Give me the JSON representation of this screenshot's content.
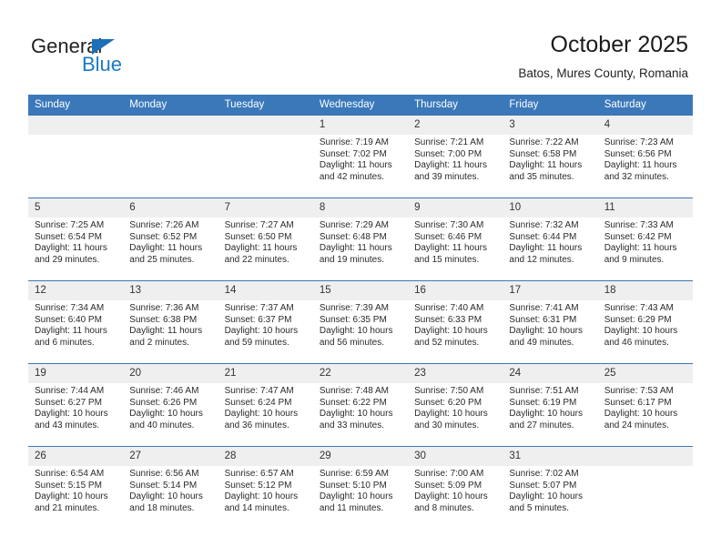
{
  "brand": {
    "name_top": "General",
    "name_bottom": "Blue",
    "triangle_color": "#1d6fb8",
    "blue_color": "#1d7ac2"
  },
  "header": {
    "title": "October 2025",
    "subtitle": "Batos, Mures County, Romania"
  },
  "theme": {
    "header_blue": "#3a78ba",
    "daynum_bg": "#efeff0",
    "text": "#2a2a2a"
  },
  "weekdays": [
    "Sunday",
    "Monday",
    "Tuesday",
    "Wednesday",
    "Thursday",
    "Friday",
    "Saturday"
  ],
  "labels": {
    "sunrise": "Sunrise:",
    "sunset": "Sunset:",
    "daylight": "Daylight:"
  },
  "weeks": [
    [
      {
        "day": "",
        "blank": true
      },
      {
        "day": "",
        "blank": true
      },
      {
        "day": "",
        "blank": true
      },
      {
        "day": "1",
        "sunrise": "Sunrise: 7:19 AM",
        "sunset": "Sunset: 7:02 PM",
        "daylight_1": "Daylight: 11 hours",
        "daylight_2": "and 42 minutes."
      },
      {
        "day": "2",
        "sunrise": "Sunrise: 7:21 AM",
        "sunset": "Sunset: 7:00 PM",
        "daylight_1": "Daylight: 11 hours",
        "daylight_2": "and 39 minutes."
      },
      {
        "day": "3",
        "sunrise": "Sunrise: 7:22 AM",
        "sunset": "Sunset: 6:58 PM",
        "daylight_1": "Daylight: 11 hours",
        "daylight_2": "and 35 minutes."
      },
      {
        "day": "4",
        "sunrise": "Sunrise: 7:23 AM",
        "sunset": "Sunset: 6:56 PM",
        "daylight_1": "Daylight: 11 hours",
        "daylight_2": "and 32 minutes."
      }
    ],
    [
      {
        "day": "5",
        "sunrise": "Sunrise: 7:25 AM",
        "sunset": "Sunset: 6:54 PM",
        "daylight_1": "Daylight: 11 hours",
        "daylight_2": "and 29 minutes."
      },
      {
        "day": "6",
        "sunrise": "Sunrise: 7:26 AM",
        "sunset": "Sunset: 6:52 PM",
        "daylight_1": "Daylight: 11 hours",
        "daylight_2": "and 25 minutes."
      },
      {
        "day": "7",
        "sunrise": "Sunrise: 7:27 AM",
        "sunset": "Sunset: 6:50 PM",
        "daylight_1": "Daylight: 11 hours",
        "daylight_2": "and 22 minutes."
      },
      {
        "day": "8",
        "sunrise": "Sunrise: 7:29 AM",
        "sunset": "Sunset: 6:48 PM",
        "daylight_1": "Daylight: 11 hours",
        "daylight_2": "and 19 minutes."
      },
      {
        "day": "9",
        "sunrise": "Sunrise: 7:30 AM",
        "sunset": "Sunset: 6:46 PM",
        "daylight_1": "Daylight: 11 hours",
        "daylight_2": "and 15 minutes."
      },
      {
        "day": "10",
        "sunrise": "Sunrise: 7:32 AM",
        "sunset": "Sunset: 6:44 PM",
        "daylight_1": "Daylight: 11 hours",
        "daylight_2": "and 12 minutes."
      },
      {
        "day": "11",
        "sunrise": "Sunrise: 7:33 AM",
        "sunset": "Sunset: 6:42 PM",
        "daylight_1": "Daylight: 11 hours",
        "daylight_2": "and 9 minutes."
      }
    ],
    [
      {
        "day": "12",
        "sunrise": "Sunrise: 7:34 AM",
        "sunset": "Sunset: 6:40 PM",
        "daylight_1": "Daylight: 11 hours",
        "daylight_2": "and 6 minutes."
      },
      {
        "day": "13",
        "sunrise": "Sunrise: 7:36 AM",
        "sunset": "Sunset: 6:38 PM",
        "daylight_1": "Daylight: 11 hours",
        "daylight_2": "and 2 minutes."
      },
      {
        "day": "14",
        "sunrise": "Sunrise: 7:37 AM",
        "sunset": "Sunset: 6:37 PM",
        "daylight_1": "Daylight: 10 hours",
        "daylight_2": "and 59 minutes."
      },
      {
        "day": "15",
        "sunrise": "Sunrise: 7:39 AM",
        "sunset": "Sunset: 6:35 PM",
        "daylight_1": "Daylight: 10 hours",
        "daylight_2": "and 56 minutes."
      },
      {
        "day": "16",
        "sunrise": "Sunrise: 7:40 AM",
        "sunset": "Sunset: 6:33 PM",
        "daylight_1": "Daylight: 10 hours",
        "daylight_2": "and 52 minutes."
      },
      {
        "day": "17",
        "sunrise": "Sunrise: 7:41 AM",
        "sunset": "Sunset: 6:31 PM",
        "daylight_1": "Daylight: 10 hours",
        "daylight_2": "and 49 minutes."
      },
      {
        "day": "18",
        "sunrise": "Sunrise: 7:43 AM",
        "sunset": "Sunset: 6:29 PM",
        "daylight_1": "Daylight: 10 hours",
        "daylight_2": "and 46 minutes."
      }
    ],
    [
      {
        "day": "19",
        "sunrise": "Sunrise: 7:44 AM",
        "sunset": "Sunset: 6:27 PM",
        "daylight_1": "Daylight: 10 hours",
        "daylight_2": "and 43 minutes."
      },
      {
        "day": "20",
        "sunrise": "Sunrise: 7:46 AM",
        "sunset": "Sunset: 6:26 PM",
        "daylight_1": "Daylight: 10 hours",
        "daylight_2": "and 40 minutes."
      },
      {
        "day": "21",
        "sunrise": "Sunrise: 7:47 AM",
        "sunset": "Sunset: 6:24 PM",
        "daylight_1": "Daylight: 10 hours",
        "daylight_2": "and 36 minutes."
      },
      {
        "day": "22",
        "sunrise": "Sunrise: 7:48 AM",
        "sunset": "Sunset: 6:22 PM",
        "daylight_1": "Daylight: 10 hours",
        "daylight_2": "and 33 minutes."
      },
      {
        "day": "23",
        "sunrise": "Sunrise: 7:50 AM",
        "sunset": "Sunset: 6:20 PM",
        "daylight_1": "Daylight: 10 hours",
        "daylight_2": "and 30 minutes."
      },
      {
        "day": "24",
        "sunrise": "Sunrise: 7:51 AM",
        "sunset": "Sunset: 6:19 PM",
        "daylight_1": "Daylight: 10 hours",
        "daylight_2": "and 27 minutes."
      },
      {
        "day": "25",
        "sunrise": "Sunrise: 7:53 AM",
        "sunset": "Sunset: 6:17 PM",
        "daylight_1": "Daylight: 10 hours",
        "daylight_2": "and 24 minutes."
      }
    ],
    [
      {
        "day": "26",
        "sunrise": "Sunrise: 6:54 AM",
        "sunset": "Sunset: 5:15 PM",
        "daylight_1": "Daylight: 10 hours",
        "daylight_2": "and 21 minutes."
      },
      {
        "day": "27",
        "sunrise": "Sunrise: 6:56 AM",
        "sunset": "Sunset: 5:14 PM",
        "daylight_1": "Daylight: 10 hours",
        "daylight_2": "and 18 minutes."
      },
      {
        "day": "28",
        "sunrise": "Sunrise: 6:57 AM",
        "sunset": "Sunset: 5:12 PM",
        "daylight_1": "Daylight: 10 hours",
        "daylight_2": "and 14 minutes."
      },
      {
        "day": "29",
        "sunrise": "Sunrise: 6:59 AM",
        "sunset": "Sunset: 5:10 PM",
        "daylight_1": "Daylight: 10 hours",
        "daylight_2": "and 11 minutes."
      },
      {
        "day": "30",
        "sunrise": "Sunrise: 7:00 AM",
        "sunset": "Sunset: 5:09 PM",
        "daylight_1": "Daylight: 10 hours",
        "daylight_2": "and 8 minutes."
      },
      {
        "day": "31",
        "sunrise": "Sunrise: 7:02 AM",
        "sunset": "Sunset: 5:07 PM",
        "daylight_1": "Daylight: 10 hours",
        "daylight_2": "and 5 minutes."
      },
      {
        "day": "",
        "blank": true
      }
    ]
  ]
}
